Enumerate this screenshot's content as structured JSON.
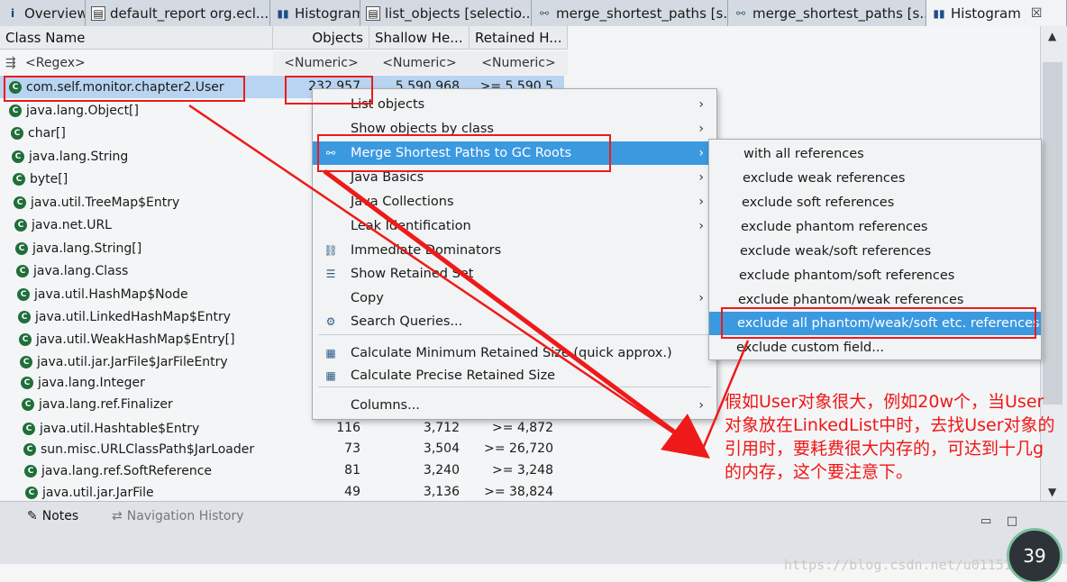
{
  "tabs": [
    {
      "label": "Overview",
      "icon": "info-icon"
    },
    {
      "label": "default_report  org.ecl...",
      "icon": "document-icon"
    },
    {
      "label": "Histogram",
      "icon": "histogram-icon"
    },
    {
      "label": "list_objects [selectio...",
      "icon": "document-icon"
    },
    {
      "label": "merge_shortest_paths [s...",
      "icon": "tree-icon"
    },
    {
      "label": "merge_shortest_paths [s...",
      "icon": "tree-icon"
    },
    {
      "label": "Histogram",
      "icon": "histogram-icon",
      "active": true
    }
  ],
  "table": {
    "columns": [
      "Class Name",
      "Objects",
      "Shallow He...",
      "Retained H..."
    ],
    "filter": {
      "regex": "<Regex>",
      "numeric": "<Numeric>"
    },
    "rows": [
      {
        "name": "com.self.monitor.chapter2.User",
        "objects": "232,957",
        "shallow": "5,590,968",
        "retained": ">= 5,590,5"
      },
      {
        "name": "java.lang.Object[]"
      },
      {
        "name": "char[]"
      },
      {
        "name": "java.lang.String"
      },
      {
        "name": "byte[]"
      },
      {
        "name": "java.util.TreeMap$Entry"
      },
      {
        "name": "java.net.URL"
      },
      {
        "name": "java.lang.String[]"
      },
      {
        "name": "java.lang.Class"
      },
      {
        "name": "java.util.HashMap$Node"
      },
      {
        "name": "java.util.LinkedHashMap$Entry"
      },
      {
        "name": "java.util.WeakHashMap$Entry[]"
      },
      {
        "name": "java.util.jar.JarFile$JarFileEntry"
      },
      {
        "name": "java.lang.Integer"
      },
      {
        "name": "java.lang.ref.Finalizer"
      },
      {
        "name": "java.util.Hashtable$Entry",
        "objects": "116",
        "shallow": "3,712",
        "retained": ">= 4,872"
      },
      {
        "name": "sun.misc.URLClassPath$JarLoader",
        "objects": "73",
        "shallow": "3,504",
        "retained": ">= 26,720"
      },
      {
        "name": "java.lang.ref.SoftReference",
        "objects": "81",
        "shallow": "3,240",
        "retained": ">= 3,248"
      },
      {
        "name": "java.util.jar.JarFile",
        "objects": "49",
        "shallow": "3,136",
        "retained": ">= 38,824"
      }
    ]
  },
  "context_menu": {
    "items": [
      {
        "label": "List objects",
        "submenu": true
      },
      {
        "label": "Show objects by class",
        "submenu": true
      },
      {
        "label": "Merge Shortest Paths to GC Roots",
        "submenu": true,
        "highlighted": true
      },
      {
        "label": "Java Basics",
        "submenu": true
      },
      {
        "label": "Java Collections",
        "submenu": true
      },
      {
        "label": "Leak Identification",
        "submenu": true
      },
      {
        "label": "Immediate Dominators"
      },
      {
        "label": "Show Retained Set"
      },
      {
        "label": "Copy",
        "submenu": true
      },
      {
        "label": "Search Queries..."
      },
      {
        "label": "Calculate Minimum Retained Size (quick approx.)"
      },
      {
        "label": "Calculate Precise Retained Size"
      },
      {
        "label": "Columns...",
        "submenu": true
      }
    ],
    "submenu_arrow": "›"
  },
  "submenu": {
    "items": [
      {
        "label": "with all references"
      },
      {
        "label": "exclude weak references"
      },
      {
        "label": "exclude soft references"
      },
      {
        "label": "exclude phantom references"
      },
      {
        "label": "exclude weak/soft references"
      },
      {
        "label": "exclude phantom/soft references"
      },
      {
        "label": "exclude phantom/weak references"
      },
      {
        "label": "exclude all phantom/weak/soft etc. references",
        "highlighted": true
      },
      {
        "label": "exclude custom field..."
      }
    ]
  },
  "bottom_panel": {
    "tabs": [
      {
        "label": "Notes",
        "icon": "notes-icon"
      },
      {
        "label": "Navigation History",
        "icon": "history-icon"
      }
    ]
  },
  "annotation": {
    "text": "假如User对象很大，例如20w个，当User对象放在LinkedList中时，去找User对象的引用时，要耗费很大内存的，可达到十几g的内存，这个要注意下。",
    "color": "#f01616"
  },
  "watermark": "https://blog.csdn.net/u011511",
  "battery_badge": "39",
  "colors": {
    "selection": "#b8d4f0",
    "menu_highlight": "#3b99e0",
    "annotation_red": "#ee1a1a"
  }
}
